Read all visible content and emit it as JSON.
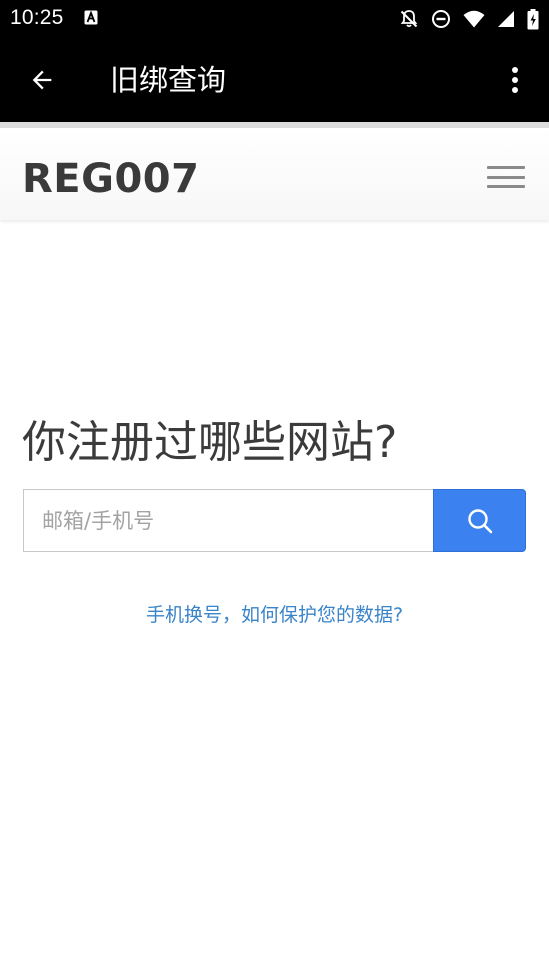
{
  "status_bar": {
    "time": "10:25",
    "icons": [
      "a-notification-icon",
      "notifications-off-icon",
      "do-not-disturb-icon",
      "wifi-icon",
      "signal-icon",
      "battery-charging-icon"
    ]
  },
  "app_bar": {
    "title": "旧绑查询",
    "back_icon": "arrow-left-icon",
    "more_icon": "more-vertical-icon"
  },
  "site_header": {
    "logo": "REG007",
    "menu_icon": "hamburger-menu-icon"
  },
  "main": {
    "heading": "你注册过哪些网站?",
    "search": {
      "placeholder": "邮箱/手机号",
      "value": "",
      "button_icon": "search-icon"
    },
    "help_link": "手机换号，如何保护您的数据?"
  },
  "colors": {
    "status_bar_bg": "#000000",
    "app_bar_bg": "#000000",
    "search_button": "#3b82f0",
    "link": "#3a84c9",
    "heading": "#3b3b3b"
  }
}
